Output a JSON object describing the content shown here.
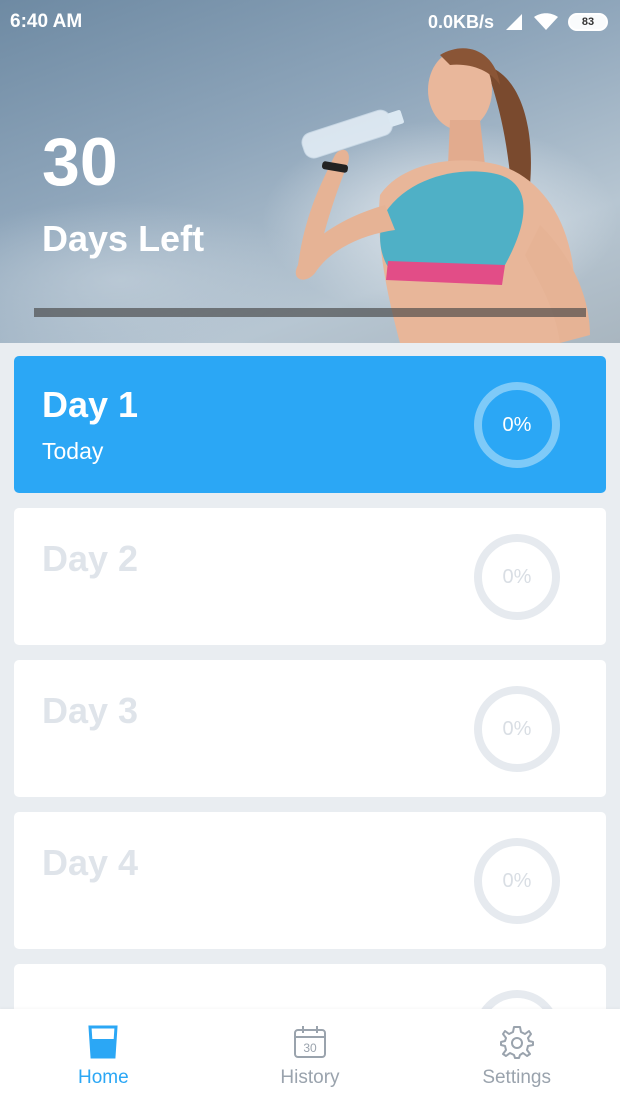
{
  "status_bar": {
    "time": "6:40 AM",
    "network_speed": "0.0KB/s",
    "battery": "83"
  },
  "hero": {
    "days_number": "30",
    "days_label": "Days Left",
    "progress_fraction": 0.0
  },
  "days": [
    {
      "title": "Day 1",
      "subtitle": "Today",
      "percent": "0%",
      "active": true
    },
    {
      "title": "Day 2",
      "subtitle": "",
      "percent": "0%",
      "active": false
    },
    {
      "title": "Day 3",
      "subtitle": "",
      "percent": "0%",
      "active": false
    },
    {
      "title": "Day 4",
      "subtitle": "",
      "percent": "0%",
      "active": false
    }
  ],
  "bottom_nav": {
    "items": [
      {
        "label": "Home",
        "icon": "water-glass-icon"
      },
      {
        "label": "History",
        "icon": "calendar-icon",
        "icon_text": "30"
      },
      {
        "label": "Settings",
        "icon": "gear-icon"
      }
    ]
  },
  "colors": {
    "accent": "#2ba7f5",
    "card_inactive_text": "#dfe4ea",
    "background": "#e9edf1"
  }
}
